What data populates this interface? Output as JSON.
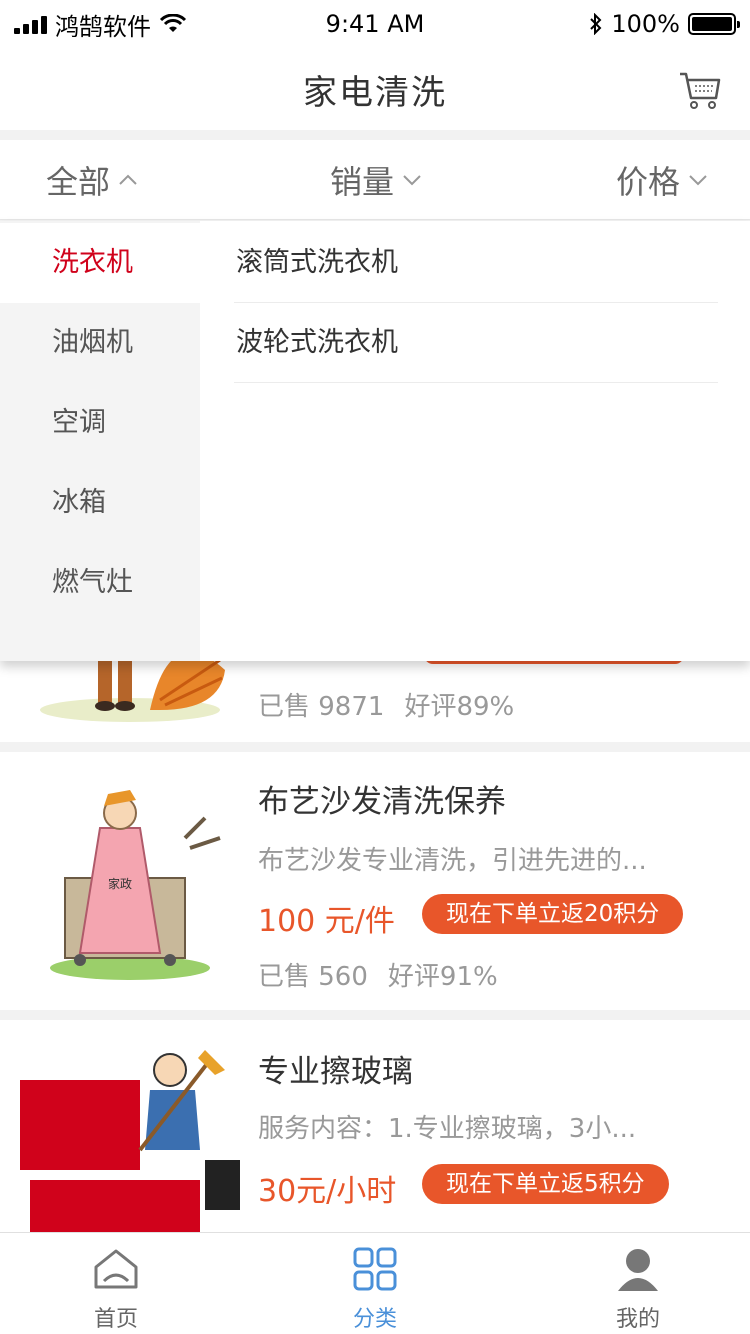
{
  "status_bar": {
    "carrier": "鸿鹄软件",
    "time": "9:41 AM",
    "battery": "100%"
  },
  "nav": {
    "title": "家电清洗",
    "cart_icon": "cart-icon"
  },
  "filters": [
    {
      "label": "全部",
      "icon": "chevron-up-icon"
    },
    {
      "label": "销量",
      "icon": "chevron-down-icon"
    },
    {
      "label": "价格",
      "icon": "chevron-down-icon"
    }
  ],
  "dropdown": {
    "categories": [
      "洗衣机",
      "油烟机",
      "空调",
      "冰箱",
      "燃气灶"
    ],
    "active_category": "洗衣机",
    "subcategories": [
      "滚筒式洗衣机",
      "波轮式洗衣机"
    ]
  },
  "products": [
    {
      "sold": "已售 9871",
      "rating": "好评89%"
    },
    {
      "name": "布艺沙发清洗保养",
      "desc": "布艺沙发专业清洗，引进先进的...",
      "price": "100 元/件",
      "promo": "现在下单立返20积分",
      "sold": "已售 560",
      "rating": "好评91%"
    },
    {
      "name": "专业擦玻璃",
      "desc": "服务内容：1.专业擦玻璃，3小...",
      "price": "30元/小时",
      "promo": "现在下单立返5积分"
    }
  ],
  "tabs": [
    {
      "label": "首页",
      "icon": "home-icon"
    },
    {
      "label": "分类",
      "icon": "category-grid-icon"
    },
    {
      "label": "我的",
      "icon": "user-icon"
    }
  ],
  "colors": {
    "accent_blue": "#4a90d9",
    "price_orange": "#e8562a",
    "active_red": "#d0021b"
  }
}
